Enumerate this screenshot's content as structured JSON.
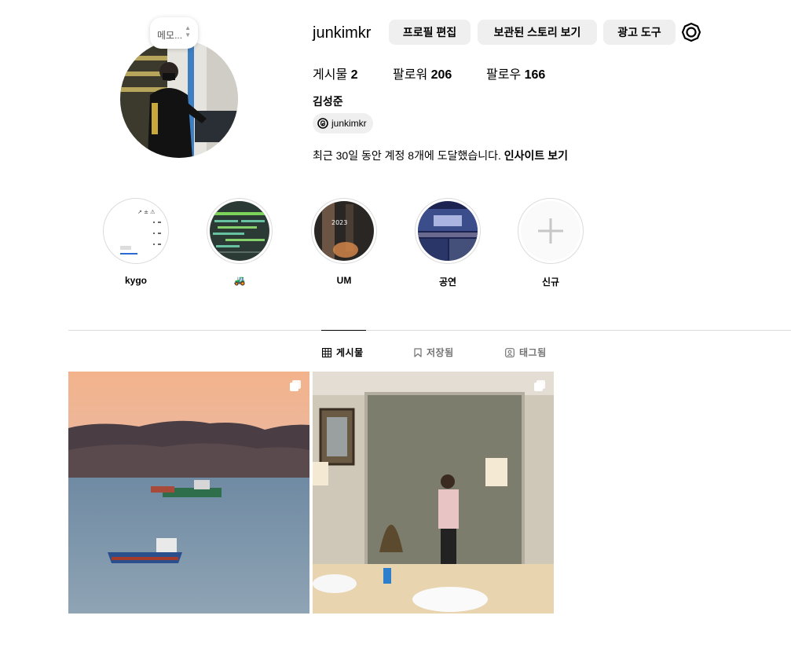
{
  "profile": {
    "username": "junkimkr",
    "full_name": "김성준",
    "note_placeholder": "메모...",
    "threads_handle": "junkimkr",
    "insight_text": "최근 30일 동안 계정 8개에 도달했습니다.",
    "insight_link": "인사이트 보기"
  },
  "actions": {
    "edit_profile": "프로필 편집",
    "archived_stories": "보관된 스토리 보기",
    "ad_tools": "광고 도구",
    "settings_icon": "gear-icon"
  },
  "stats": {
    "posts_label": "게시물",
    "posts_count": "2",
    "followers_label": "팔로워",
    "followers_count": "206",
    "following_label": "팔로우",
    "following_count": "166"
  },
  "highlights": [
    {
      "label": "kygo"
    },
    {
      "label": "🚜"
    },
    {
      "label": "UM"
    },
    {
      "label": "공연"
    },
    {
      "label": "신규"
    }
  ],
  "tabs": [
    {
      "label": "게시물",
      "icon": "grid-icon",
      "active": true
    },
    {
      "label": "저장됨",
      "icon": "bookmark-icon",
      "active": false
    },
    {
      "label": "태그됨",
      "icon": "tag-person-icon",
      "active": false
    }
  ],
  "colors": {
    "button_bg": "#efefef",
    "divider": "#dbdbdb",
    "muted_text": "#737373"
  }
}
